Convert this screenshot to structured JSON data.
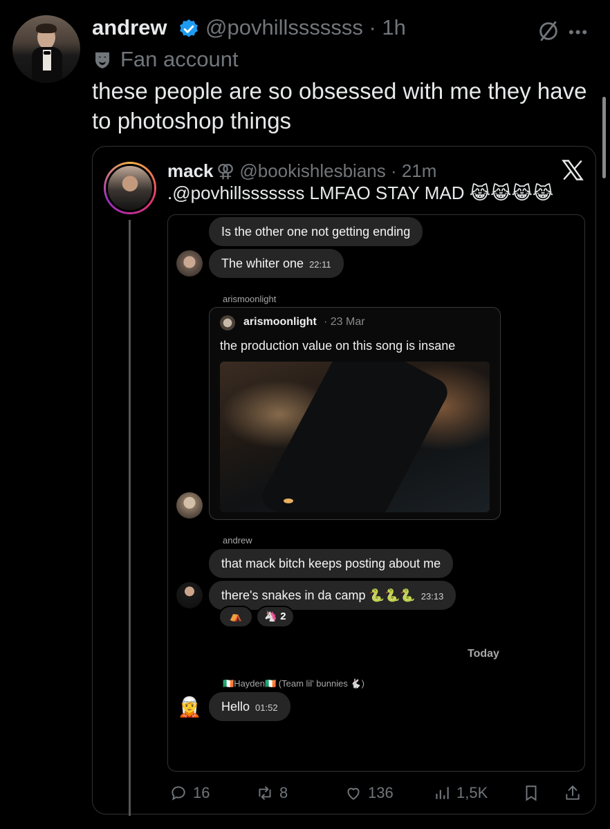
{
  "tweet": {
    "display_name": "andrew",
    "handle_meta": "@povhillsssssss · 1h",
    "badge_text": "Fan account",
    "text": "these people are so obsessed with me they have to photoshop things"
  },
  "quote": {
    "name": "mack",
    "handle_meta": "⚢ @bookishlesbians · 21m",
    "text": ".@povhillsssssss LMFAO STAY MAD 😹😹😹😹"
  },
  "dm": {
    "messages": [
      {
        "text": "Is the other one not getting ending",
        "time": ""
      },
      {
        "text": "The whiter one",
        "time": "22:11"
      },
      {
        "text": "that mack bitch keeps posting about me",
        "time": ""
      },
      {
        "text": "there's snakes in da camp 🐍🐍🐍",
        "time": "23:13"
      },
      {
        "text": "Hello",
        "time": "01:52"
      }
    ],
    "sender_labels": [
      "arismoonlight",
      "andrew",
      "🇮🇪Hayden🇮🇪 (Team lil' bunnies 🐇)"
    ],
    "shared_post": {
      "author": "arismoonlight",
      "date": "· 23 Mar",
      "text": "the production value on this song is insane"
    },
    "reactions": [
      {
        "emoji": "⛺",
        "count": ""
      },
      {
        "emoji": "🦄",
        "count": "2"
      }
    ],
    "date_divider": "Today",
    "avatar4_emoji": "🧝"
  },
  "actions": {
    "replies": "16",
    "reposts": "8",
    "likes": "136",
    "views": "1,5K"
  },
  "icons": [
    "verified-icon",
    "grok-icon",
    "more-icon",
    "fan-badge-icon",
    "x-logo-icon",
    "reply-icon",
    "repost-icon",
    "like-icon",
    "views-icon",
    "bookmark-icon",
    "share-icon"
  ],
  "colors": {
    "background": "#000000",
    "text": "#e7e9ea",
    "muted": "#71767b",
    "verified": "#1d9bf0",
    "bubble": "#262626",
    "border": "#2f3336"
  }
}
